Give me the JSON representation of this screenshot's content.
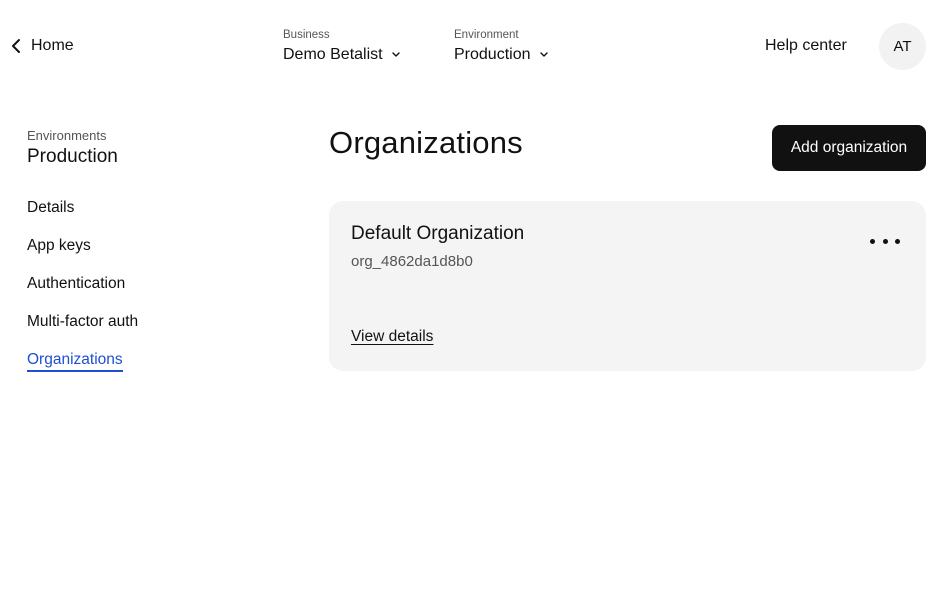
{
  "header": {
    "home_label": "Home",
    "business": {
      "caption": "Business",
      "value": "Demo Betalist"
    },
    "environment": {
      "caption": "Environment",
      "value": "Production"
    },
    "help_label": "Help center",
    "avatar_initials": "AT"
  },
  "sidebar": {
    "caption": "Environments",
    "title": "Production",
    "items": [
      {
        "label": "Details"
      },
      {
        "label": "App keys"
      },
      {
        "label": "Authentication"
      },
      {
        "label": "Multi-factor auth"
      },
      {
        "label": "Organizations",
        "active": true
      }
    ],
    "active_color": "#1f4fd1"
  },
  "main": {
    "title": "Organizations",
    "add_button_label": "Add organization",
    "organizations": [
      {
        "name": "Default Organization",
        "id": "org_4862da1d8b0",
        "link_label": "View details"
      }
    ]
  }
}
